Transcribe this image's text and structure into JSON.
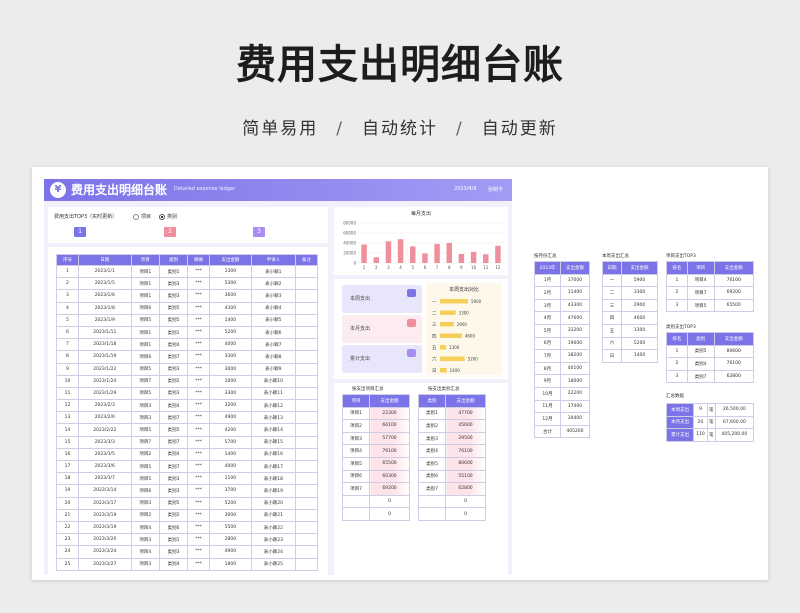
{
  "hero": {
    "title": "费用支出明细台账",
    "subtitle": [
      "简单易用",
      "自动统计",
      "自动更新"
    ],
    "separator": "/"
  },
  "banner": {
    "logo": "¥",
    "title": "费用支出明细台账",
    "subtitle": "Detailed expense ledger",
    "date": "2023/4/9",
    "user": "张制卡"
  },
  "top3": {
    "label": "费用支出TOP3（实时更新）",
    "options": [
      "项目",
      "类别"
    ],
    "selected": 1,
    "boxes": [
      "1",
      "2",
      "3"
    ],
    "colors": [
      "#7b73e8",
      "#ef8f9b",
      "#a88ef0"
    ]
  },
  "ledger": {
    "headers": [
      "序号",
      "日期",
      "项目",
      "类别",
      "摘要",
      "支出金额",
      "申请人",
      "备注"
    ],
    "rows": [
      [
        "1",
        "2023/1/1",
        "项目1",
        "类别1",
        "***",
        "1300",
        "表小颖1",
        ""
      ],
      [
        "2",
        "2023/1/5",
        "项目1",
        "类别3",
        "***",
        "5300",
        "表小颖2",
        ""
      ],
      [
        "3",
        "2023/1/6",
        "项目1",
        "类别3",
        "***",
        "3600",
        "表小颖3",
        ""
      ],
      [
        "4",
        "2023/1/8",
        "项目6",
        "类别5",
        "***",
        "4300",
        "表小颖4",
        ""
      ],
      [
        "5",
        "2023/1/9",
        "项目5",
        "类别5",
        "***",
        "1400",
        "表小颖5",
        ""
      ],
      [
        "6",
        "2023/1/11",
        "项目1",
        "类别1",
        "***",
        "5200",
        "表小颖6",
        ""
      ],
      [
        "7",
        "2023/1/18",
        "项目1",
        "类别4",
        "***",
        "4000",
        "表小颖7",
        ""
      ],
      [
        "8",
        "2023/1/19",
        "项目6",
        "类别7",
        "***",
        "3300",
        "表小颖8",
        ""
      ],
      [
        "9",
        "2023/1/22",
        "项目5",
        "类别3",
        "***",
        "3000",
        "表小颖9",
        ""
      ],
      [
        "10",
        "2023/1/24",
        "项目7",
        "类别2",
        "***",
        "1000",
        "表小颖10",
        ""
      ],
      [
        "11",
        "2023/1/29",
        "项目5",
        "类别3",
        "***",
        "3300",
        "表小颖11",
        ""
      ],
      [
        "12",
        "2023/2/3",
        "项目3",
        "类别4",
        "***",
        "3200",
        "表小颖12",
        ""
      ],
      [
        "13",
        "2023/2/6",
        "项目3",
        "类别7",
        "***",
        "4900",
        "表小颖13",
        ""
      ],
      [
        "14",
        "2023/2/22",
        "项目5",
        "类别5",
        "***",
        "4200",
        "表小颖14",
        ""
      ],
      [
        "15",
        "2023/3/3",
        "项目7",
        "类别7",
        "***",
        "5700",
        "表小颖15",
        ""
      ],
      [
        "16",
        "2023/3/5",
        "项目2",
        "类别4",
        "***",
        "1400",
        "表小颖16",
        ""
      ],
      [
        "17",
        "2023/3/6",
        "项目5",
        "类别7",
        "***",
        "4000",
        "表小颖17",
        ""
      ],
      [
        "18",
        "2023/3/7",
        "项目5",
        "类别3",
        "***",
        "1100",
        "表小颖18",
        ""
      ],
      [
        "19",
        "2023/3/14",
        "项目6",
        "类别3",
        "***",
        "3700",
        "表小颖19",
        ""
      ],
      [
        "20",
        "2023/3/17",
        "项目3",
        "类别5",
        "***",
        "5200",
        "表小颖20",
        ""
      ],
      [
        "21",
        "2023/3/19",
        "项目2",
        "类别2",
        "***",
        "3000",
        "表小颖21",
        ""
      ],
      [
        "22",
        "2023/3/19",
        "项目4",
        "类别6",
        "***",
        "5500",
        "表小颖22",
        ""
      ],
      [
        "23",
        "2023/3/20",
        "项目3",
        "类别1",
        "***",
        "2800",
        "表小颖23",
        ""
      ],
      [
        "24",
        "2023/3/24",
        "项目4",
        "类别3",
        "***",
        "4900",
        "表小颖24",
        ""
      ],
      [
        "25",
        "2023/3/27",
        "项目3",
        "类别4",
        "***",
        "1800",
        "表小颖25",
        ""
      ]
    ]
  },
  "monthly": {
    "title": "每月支出",
    "yticks": [
      "80000",
      "60000",
      "40000",
      "20000",
      "0"
    ]
  },
  "chart_data": [
    {
      "type": "bar",
      "title": "每月支出",
      "categories": [
        "1",
        "2",
        "3",
        "4",
        "5",
        "6",
        "7",
        "8",
        "9",
        "10",
        "11",
        "12"
      ],
      "values": [
        37000,
        11400,
        43300,
        47600,
        33200,
        19000,
        38200,
        40100,
        18000,
        22200,
        17400,
        34400
      ],
      "ylim": [
        0,
        80000
      ]
    },
    {
      "type": "bar",
      "title": "本周支出对比",
      "categories": [
        "一",
        "二",
        "三",
        "四",
        "五",
        "六",
        "日"
      ],
      "values": [
        5900,
        3300,
        2900,
        4600,
        1300,
        5200,
        1400
      ]
    }
  ],
  "stats": {
    "cards": [
      "本周支出",
      "本月支出",
      "累计支出"
    ],
    "card_colors": [
      "#e7e6fb",
      "#fdecef",
      "#e7e6fb"
    ],
    "icon_colors": [
      "#7b73e8",
      "#ef8f9b",
      "#a88ef0"
    ],
    "week_title": "本周支出对比",
    "week_bar_color": "#f6cf5b",
    "week_labels": [
      "一",
      "二",
      "三",
      "四",
      "五",
      "六",
      "日"
    ],
    "week_values": [
      "5900",
      "3300",
      "2900",
      "4600",
      "1300",
      "5200",
      "1400"
    ]
  },
  "proj_summary": {
    "caption": "按支出项目汇总",
    "headers": [
      "项目",
      "支出金额"
    ],
    "rows": [
      [
        "项目1",
        "22300"
      ],
      [
        "项目2",
        "66100"
      ],
      [
        "项目3",
        "57700"
      ],
      [
        "项目4",
        "76100"
      ],
      [
        "项目5",
        "65500"
      ],
      [
        "项目6",
        "60300"
      ],
      [
        "项目7",
        "69200"
      ],
      [
        "",
        "0"
      ],
      [
        "",
        "0"
      ]
    ]
  },
  "cat_summary": {
    "caption": "按支出类别汇总",
    "headers": [
      "类别",
      "支出金额"
    ],
    "rows": [
      [
        "类别1",
        "47700"
      ],
      [
        "类别2",
        "45600"
      ],
      [
        "类别3",
        "29500"
      ],
      [
        "类别4",
        "76100"
      ],
      [
        "类别5",
        "80600"
      ],
      [
        "类别6",
        "55100"
      ],
      [
        "类别7",
        "62800"
      ],
      [
        "",
        "0"
      ],
      [
        "",
        "0"
      ]
    ]
  },
  "month_summary": {
    "caption": "按月份汇总",
    "headers": [
      "2023年",
      "支出金额"
    ],
    "rows": [
      [
        "1月",
        "37000"
      ],
      [
        "2月",
        "11400"
      ],
      [
        "3月",
        "43300"
      ],
      [
        "4月",
        "47600"
      ],
      [
        "5月",
        "33200"
      ],
      [
        "6月",
        "19000"
      ],
      [
        "7月",
        "38200"
      ],
      [
        "8月",
        "40100"
      ],
      [
        "9月",
        "18000"
      ],
      [
        "10月",
        "22200"
      ],
      [
        "11月",
        "17400"
      ],
      [
        "12月",
        "34400"
      ],
      [
        "合计",
        "405200"
      ]
    ]
  },
  "week_summary": {
    "caption": "本周支出汇总",
    "headers": [
      "日期",
      "支出金额"
    ],
    "rows": [
      [
        "一",
        "5900"
      ],
      [
        "二",
        "3300"
      ],
      [
        "三",
        "2900"
      ],
      [
        "四",
        "4600"
      ],
      [
        "五",
        "1300"
      ],
      [
        "六",
        "5200"
      ],
      [
        "日",
        "1400"
      ]
    ]
  },
  "proj_top3": {
    "caption": "项目支出TOP3",
    "headers": [
      "排名",
      "项目",
      "支出金额"
    ],
    "rows": [
      [
        "1",
        "项目4",
        "76100"
      ],
      [
        "2",
        "项目7",
        "69200"
      ],
      [
        "3",
        "项目5",
        "65500"
      ]
    ]
  },
  "cat_top3": {
    "caption": "类别支出TOP3",
    "headers": [
      "排名",
      "类别",
      "支出金额"
    ],
    "rows": [
      [
        "1",
        "类别5",
        "80600"
      ],
      [
        "2",
        "类别4",
        "76100"
      ],
      [
        "3",
        "类别7",
        "62800"
      ]
    ]
  },
  "totals": {
    "caption": "汇总数据",
    "rows": [
      [
        "本周支出",
        "9",
        "笔",
        "26,500.00"
      ],
      [
        "本月支出",
        "20",
        "笔",
        "67,600.00"
      ],
      [
        "累计支出",
        "110",
        "笔",
        "405,200.00"
      ]
    ]
  }
}
